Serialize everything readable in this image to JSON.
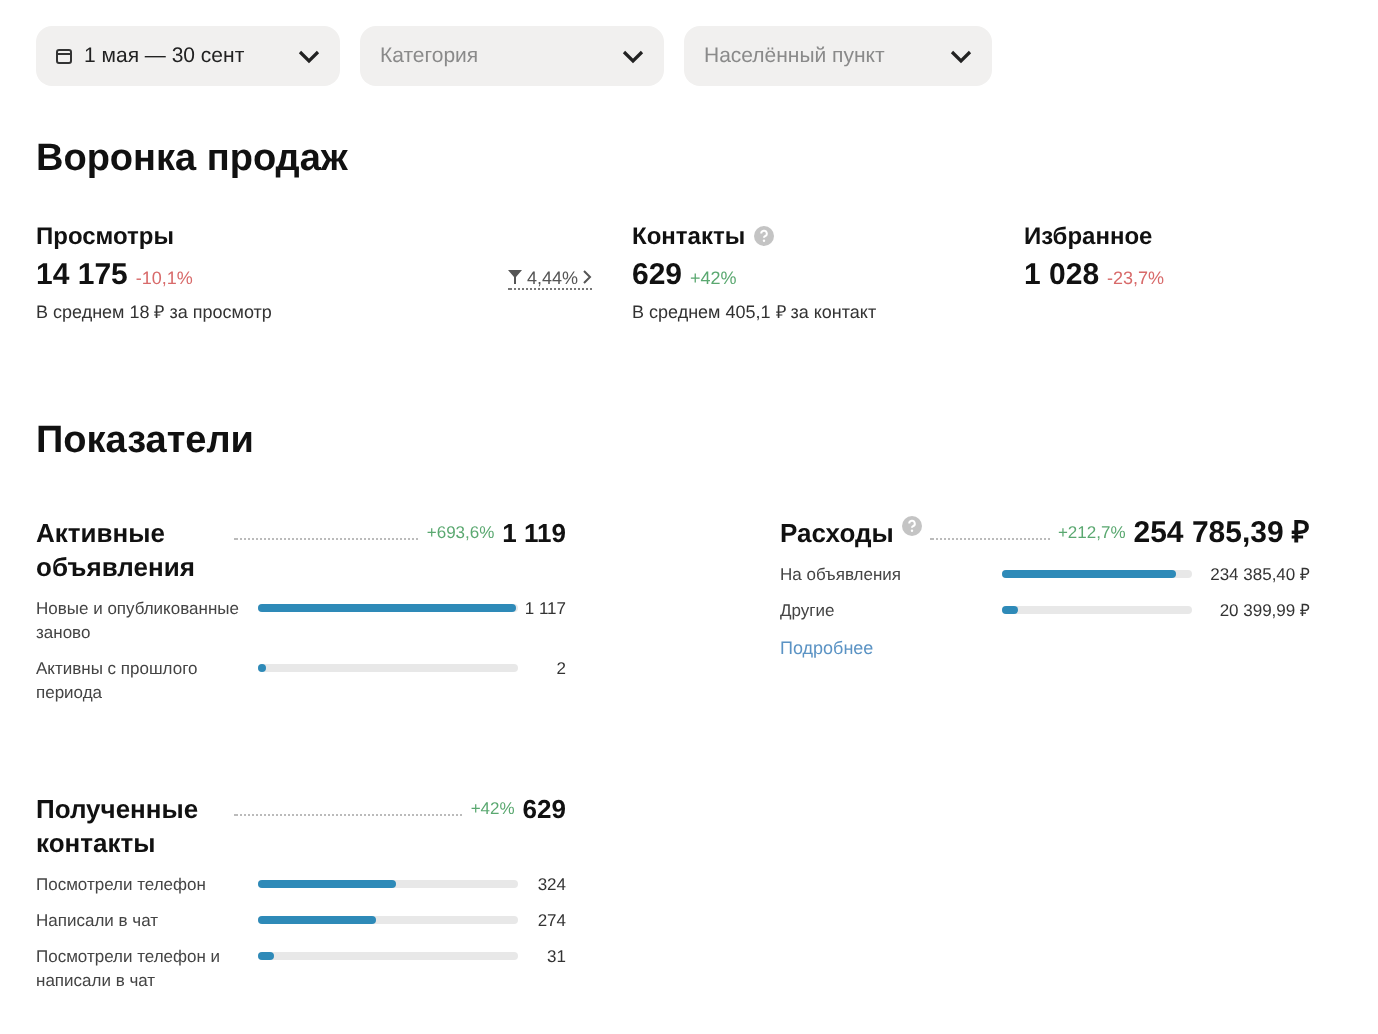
{
  "filters": [
    {
      "kind": "date",
      "value": "1 мая — 30 сент"
    },
    {
      "kind": "select",
      "placeholder": "Категория"
    },
    {
      "kind": "select",
      "placeholder": "Населённый пункт"
    }
  ],
  "funnel": {
    "title": "Воронка продаж",
    "conversion": "4,44%",
    "metrics": [
      {
        "label": "Просмотры",
        "help": false,
        "value": "14 175",
        "change": "-10,1%",
        "negative": true,
        "note": "В среднем 18 ₽ за просмотр"
      },
      {
        "label": "Контакты",
        "help": true,
        "value": "629",
        "change": "+42%",
        "negative": false,
        "note": "В среднем 405,1 ₽ за контакт"
      },
      {
        "label": "Избранное",
        "help": false,
        "value": "1 028",
        "change": "-23,7%",
        "negative": true
      }
    ]
  },
  "indicators": {
    "title": "Показатели",
    "left_column": [
      {
        "title": "Активные объявления",
        "help": false,
        "change": "+693,6%",
        "negative": false,
        "total": "1 119",
        "rows": [
          {
            "label": "Новые и опубликованные заново",
            "value": "1 117",
            "level": 0.99
          },
          {
            "label": "Активны с прошлого периода",
            "value": "2",
            "level": 0.03
          }
        ]
      },
      {
        "title": "Полученные контакты",
        "help": false,
        "change": "+42%",
        "negative": false,
        "total": "629",
        "rows": [
          {
            "label": "Посмотрели телефон",
            "value": "324",
            "level": 0.53
          },
          {
            "label": "Написали в чат",
            "value": "274",
            "level": 0.45
          },
          {
            "label": "Посмотрели телефон и написали в чат",
            "value": "31",
            "level": 0.06
          }
        ]
      }
    ],
    "right_column": [
      {
        "title": "Расходы",
        "help": true,
        "change": "+212,7%",
        "negative": false,
        "total": "254 785,39 ₽",
        "link": "Подробнее",
        "rows": [
          {
            "label": "На объявления",
            "value": "234 385,40 ₽",
            "level": 0.92
          },
          {
            "label": "Другие",
            "value": "20 399,99 ₽",
            "level": 0.08
          }
        ]
      }
    ]
  }
}
